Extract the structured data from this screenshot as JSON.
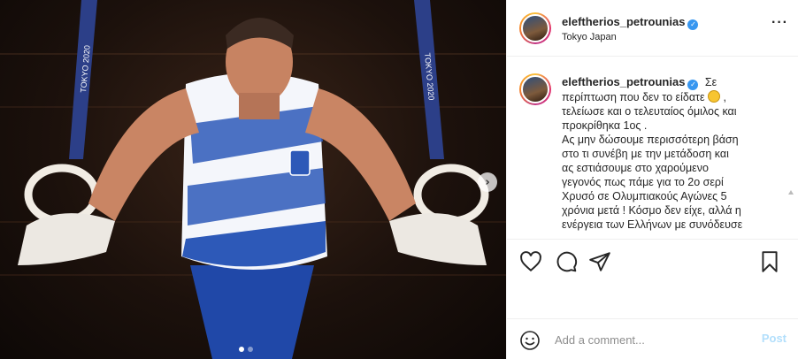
{
  "post": {
    "username": "eleftherios_petrounias",
    "location": "Tokyo Japan",
    "caption_lines": [
      "Σε",
      "περίπτωση που δεν το είδατε",
      ",",
      "τελείωσε και ο τελευταίος όμιλος και",
      "προκρίθηκα 1ος .",
      "Ας μην δώσουμε περισσότερη βάση",
      "στο τι συνέβη με την μετάδοση και",
      "ας εστιάσουμε στο χαρούμενο",
      "γεγονός πως πάμε για το 2ο σερί",
      "Χρυσό σε Ολυμπιακούς Αγώνες 5",
      "χρόνια μετά ! Κόσμο δεν είχε, αλλά η",
      "ενέργεια των Ελλήνων με συνόδευσε"
    ],
    "photo_text": {
      "ring_left": "TOKYO 2020",
      "ring_right": "TOKYO 2020"
    },
    "media_dots": 2,
    "active_dot": 0
  },
  "icons": {
    "verified": "verified-badge-icon",
    "more": "more-options-icon",
    "like": "heart-icon",
    "comment": "comment-icon",
    "share": "share-icon",
    "save": "bookmark-icon",
    "emoji": "smile-icon",
    "next": "chevron-right-icon"
  },
  "comment_box": {
    "placeholder": "Add a comment...",
    "post_label": "Post"
  },
  "colors": {
    "accent": "#3897f0",
    "post_disabled": "#b2dffc",
    "text": "#262626",
    "muted": "#8e8e8e"
  }
}
